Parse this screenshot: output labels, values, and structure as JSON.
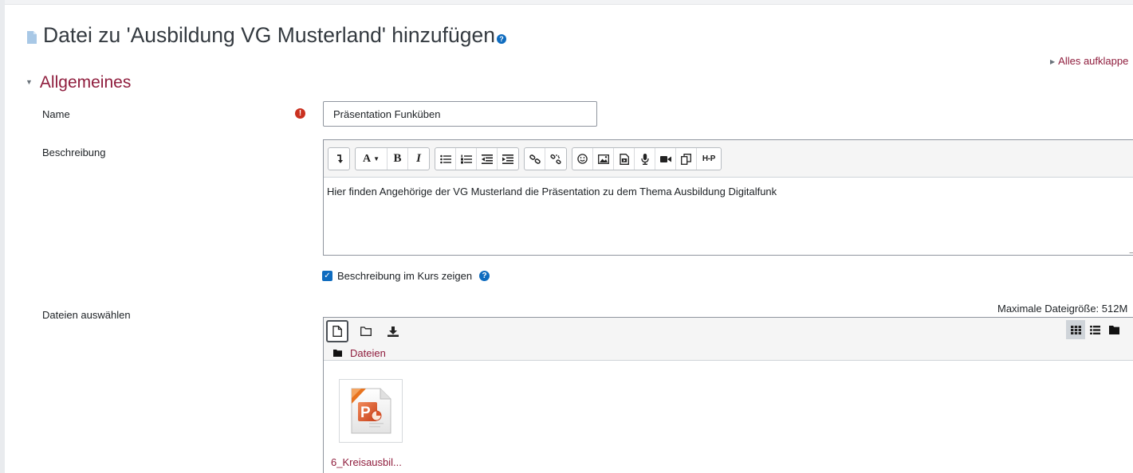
{
  "page": {
    "title": "Datei zu 'Ausbildung VG Musterland' hinzufügen",
    "expand_all": "Alles aufklappe"
  },
  "section": {
    "title": "Allgemeines"
  },
  "fields": {
    "name_label": "Name",
    "name_value": "Präsentation Funküben",
    "description_label": "Beschreibung",
    "description_text": "Hier finden Angehörige der VG Musterland die Präsentation zu dem Thema Ausbildung Digitalfunk",
    "show_description_label": "Beschreibung im Kurs zeigen",
    "show_description_checked": true,
    "files_label": "Dateien auswählen",
    "max_size": "Maximale Dateigröße: 512M"
  },
  "editor_toolbar": {
    "groups": [
      [
        "collapse-icon"
      ],
      [
        "font-style-dropdown",
        "bold-icon",
        "italic-icon"
      ],
      [
        "unordered-list-icon",
        "ordered-list-icon",
        "outdent-icon",
        "indent-icon"
      ],
      [
        "link-icon",
        "unlink-icon"
      ],
      [
        "emoji-icon",
        "image-icon",
        "media-icon",
        "record-audio-icon",
        "record-video-icon",
        "manage-files-icon",
        "h5p-icon"
      ]
    ],
    "font_label": "A",
    "bold_label": "B",
    "italic_label": "I",
    "h5p_label": "H-P"
  },
  "filepicker": {
    "path_label": "Dateien",
    "files": [
      {
        "name": "6_Kreisausbil...",
        "icon": "powerpoint-file-icon"
      }
    ]
  },
  "colors": {
    "accent": "#8f1d3d",
    "primary": "#0f6cbf",
    "required": "#ca3120"
  }
}
